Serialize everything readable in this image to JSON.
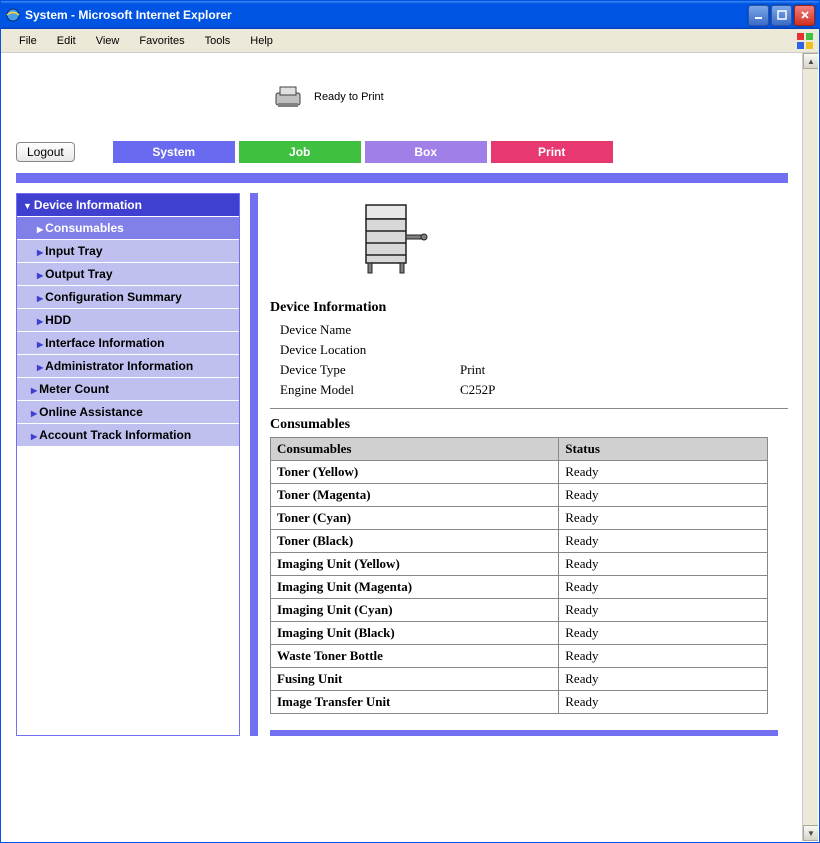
{
  "window": {
    "title": "System - Microsoft Internet Explorer"
  },
  "menubar": {
    "items": [
      "File",
      "Edit",
      "View",
      "Favorites",
      "Tools",
      "Help"
    ]
  },
  "status": {
    "text": "Ready to Print"
  },
  "logout": {
    "label": "Logout"
  },
  "tabs": {
    "system": "System",
    "job": "Job",
    "box": "Box",
    "print": "Print"
  },
  "sidebar": {
    "group1": "Device Information",
    "items": [
      "Consumables",
      "Input Tray",
      "Output Tray",
      "Configuration Summary",
      "HDD",
      "Interface Information",
      "Administrator Information"
    ],
    "meter": "Meter Count",
    "online": "Online Assistance",
    "account": "Account Track Information"
  },
  "device_info": {
    "heading": "Device Information",
    "rows": {
      "name_label": "Device Name",
      "name_value": "",
      "loc_label": "Device Location",
      "loc_value": "",
      "type_label": "Device Type",
      "type_value": "Print",
      "engine_label": "Engine Model",
      "engine_value": "C252P"
    }
  },
  "consumables": {
    "heading": "Consumables",
    "col1": "Consumables",
    "col2": "Status",
    "rows": [
      {
        "name": "Toner (Yellow)",
        "status": "Ready"
      },
      {
        "name": "Toner (Magenta)",
        "status": "Ready"
      },
      {
        "name": "Toner (Cyan)",
        "status": "Ready"
      },
      {
        "name": "Toner (Black)",
        "status": "Ready"
      },
      {
        "name": "Imaging Unit (Yellow)",
        "status": "Ready"
      },
      {
        "name": "Imaging Unit (Magenta)",
        "status": "Ready"
      },
      {
        "name": "Imaging Unit (Cyan)",
        "status": "Ready"
      },
      {
        "name": "Imaging Unit (Black)",
        "status": "Ready"
      },
      {
        "name": "Waste Toner Bottle",
        "status": "Ready"
      },
      {
        "name": "Fusing Unit",
        "status": "Ready"
      },
      {
        "name": "Image Transfer Unit",
        "status": "Ready"
      }
    ]
  }
}
